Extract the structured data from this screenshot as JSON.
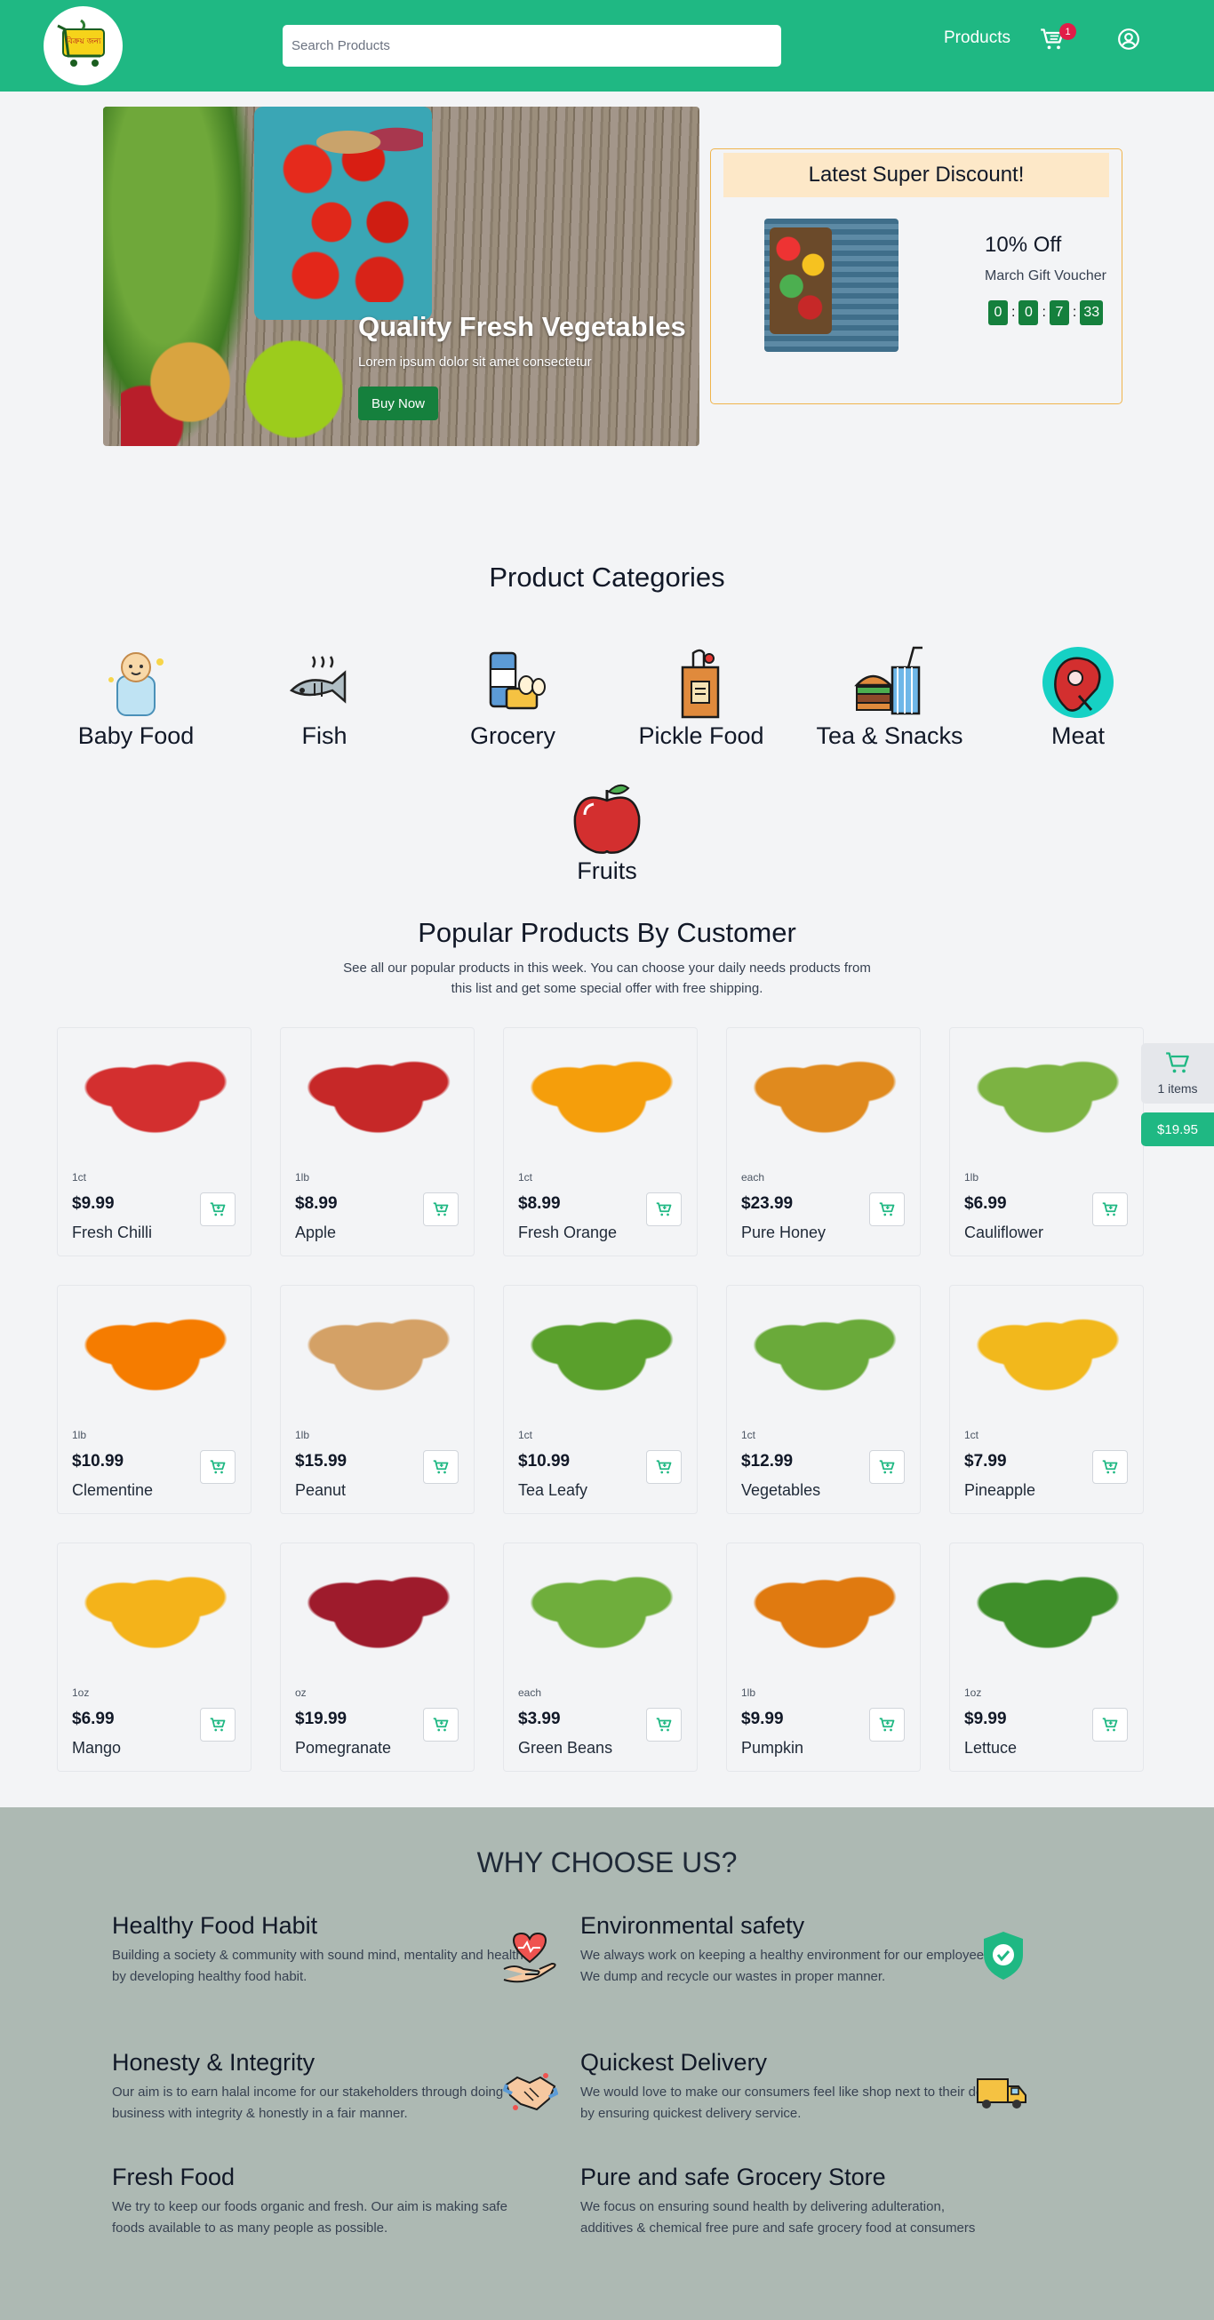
{
  "header": {
    "logo_text": "বিক্রয় জন্য",
    "search_placeholder": "Search Products",
    "nav_products": "Products",
    "cart_count": "1"
  },
  "hero": {
    "title": "Quality Fresh Vegetables",
    "subtitle": "Lorem ipsum dolor sit amet consectetur",
    "button": "Buy Now"
  },
  "discount": {
    "heading": "Latest Super Discount!",
    "percent": "10% Off",
    "name": "March Gift Voucher",
    "timer": [
      "0",
      "0",
      "7",
      "33"
    ]
  },
  "categories": {
    "title": "Product Categories",
    "items": [
      {
        "label": "Baby Food",
        "icon": "baby-icon"
      },
      {
        "label": "Fish",
        "icon": "fish-icon"
      },
      {
        "label": "Grocery",
        "icon": "grocery-icon"
      },
      {
        "label": "Pickle Food",
        "icon": "pickle-bag-icon"
      },
      {
        "label": "Tea & Snacks",
        "icon": "snacks-icon"
      },
      {
        "label": "Meat",
        "icon": "meat-icon"
      },
      {
        "label": "Fruits",
        "icon": "apple-icon"
      }
    ]
  },
  "popular": {
    "title": "Popular Products By Customer",
    "subtitle": "See all our popular products in this week. You can choose your daily needs products from this list and get some special offer with free shipping.",
    "products": [
      {
        "unit": "1ct",
        "price": "$9.99",
        "name": "Fresh Chilli",
        "color": "#d32f2f"
      },
      {
        "unit": "1lb",
        "price": "$8.99",
        "name": "Apple",
        "color": "#c62828"
      },
      {
        "unit": "1ct",
        "price": "$8.99",
        "name": "Fresh Orange",
        "color": "#f59e0b"
      },
      {
        "unit": "each",
        "price": "$23.99",
        "name": "Pure Honey",
        "color": "#e08a1e"
      },
      {
        "unit": "1lb",
        "price": "$6.99",
        "name": "Cauliflower",
        "color": "#7cb342"
      },
      {
        "unit": "1lb",
        "price": "$10.99",
        "name": "Clementine",
        "color": "#f57c00"
      },
      {
        "unit": "1lb",
        "price": "$15.99",
        "name": "Peanut",
        "color": "#d4a166"
      },
      {
        "unit": "1ct",
        "price": "$10.99",
        "name": "Tea Leafy",
        "color": "#5aa02c"
      },
      {
        "unit": "1ct",
        "price": "$12.99",
        "name": "Vegetables",
        "color": "#6aaa3a"
      },
      {
        "unit": "1ct",
        "price": "$7.99",
        "name": "Pineapple",
        "color": "#f2b81c"
      },
      {
        "unit": "1oz",
        "price": "$6.99",
        "name": "Mango",
        "color": "#f4b31a"
      },
      {
        "unit": "oz",
        "price": "$19.99",
        "name": "Pomegranate",
        "color": "#9e1b2c"
      },
      {
        "unit": "each",
        "price": "$3.99",
        "name": "Green Beans",
        "color": "#6fae3c"
      },
      {
        "unit": "1lb",
        "price": "$9.99",
        "name": "Pumpkin",
        "color": "#e07a10"
      },
      {
        "unit": "1oz",
        "price": "$9.99",
        "name": "Lettuce",
        "color": "#3f8f2a"
      }
    ]
  },
  "floating_cart": {
    "items": "1 items",
    "total": "$19.95"
  },
  "why": {
    "title": "WHY CHOOSE US?",
    "features": [
      {
        "title": "Healthy Food Habit",
        "desc": "Building a society & community with sound mind, mentality and health by developing healthy food habit.",
        "icon": "heart-hand-icon"
      },
      {
        "title": "Environmental safety",
        "desc": "We always work on keeping a healthy environment for our employees. We dump and recycle our wastes in proper manner.",
        "icon": "shield-check-icon"
      },
      {
        "title": "Honesty & Integrity",
        "desc": "Our aim is to earn halal income for our stakeholders through doing business with integrity & honestly in a fair manner.",
        "icon": "handshake-icon"
      },
      {
        "title": "Quickest Delivery",
        "desc": "We would love to make our consumers feel like shop next to their door by ensuring quickest delivery service.",
        "icon": "truck-icon"
      },
      {
        "title": "Fresh Food",
        "desc": "We try to keep our foods organic and fresh. Our aim is making safe foods available to as many people as possible.",
        "icon": ""
      },
      {
        "title": "Pure and safe Grocery Store",
        "desc": "We focus on ensuring sound health by delivering adulteration, additives & chemical free pure and safe grocery food at consumers",
        "icon": ""
      }
    ]
  }
}
